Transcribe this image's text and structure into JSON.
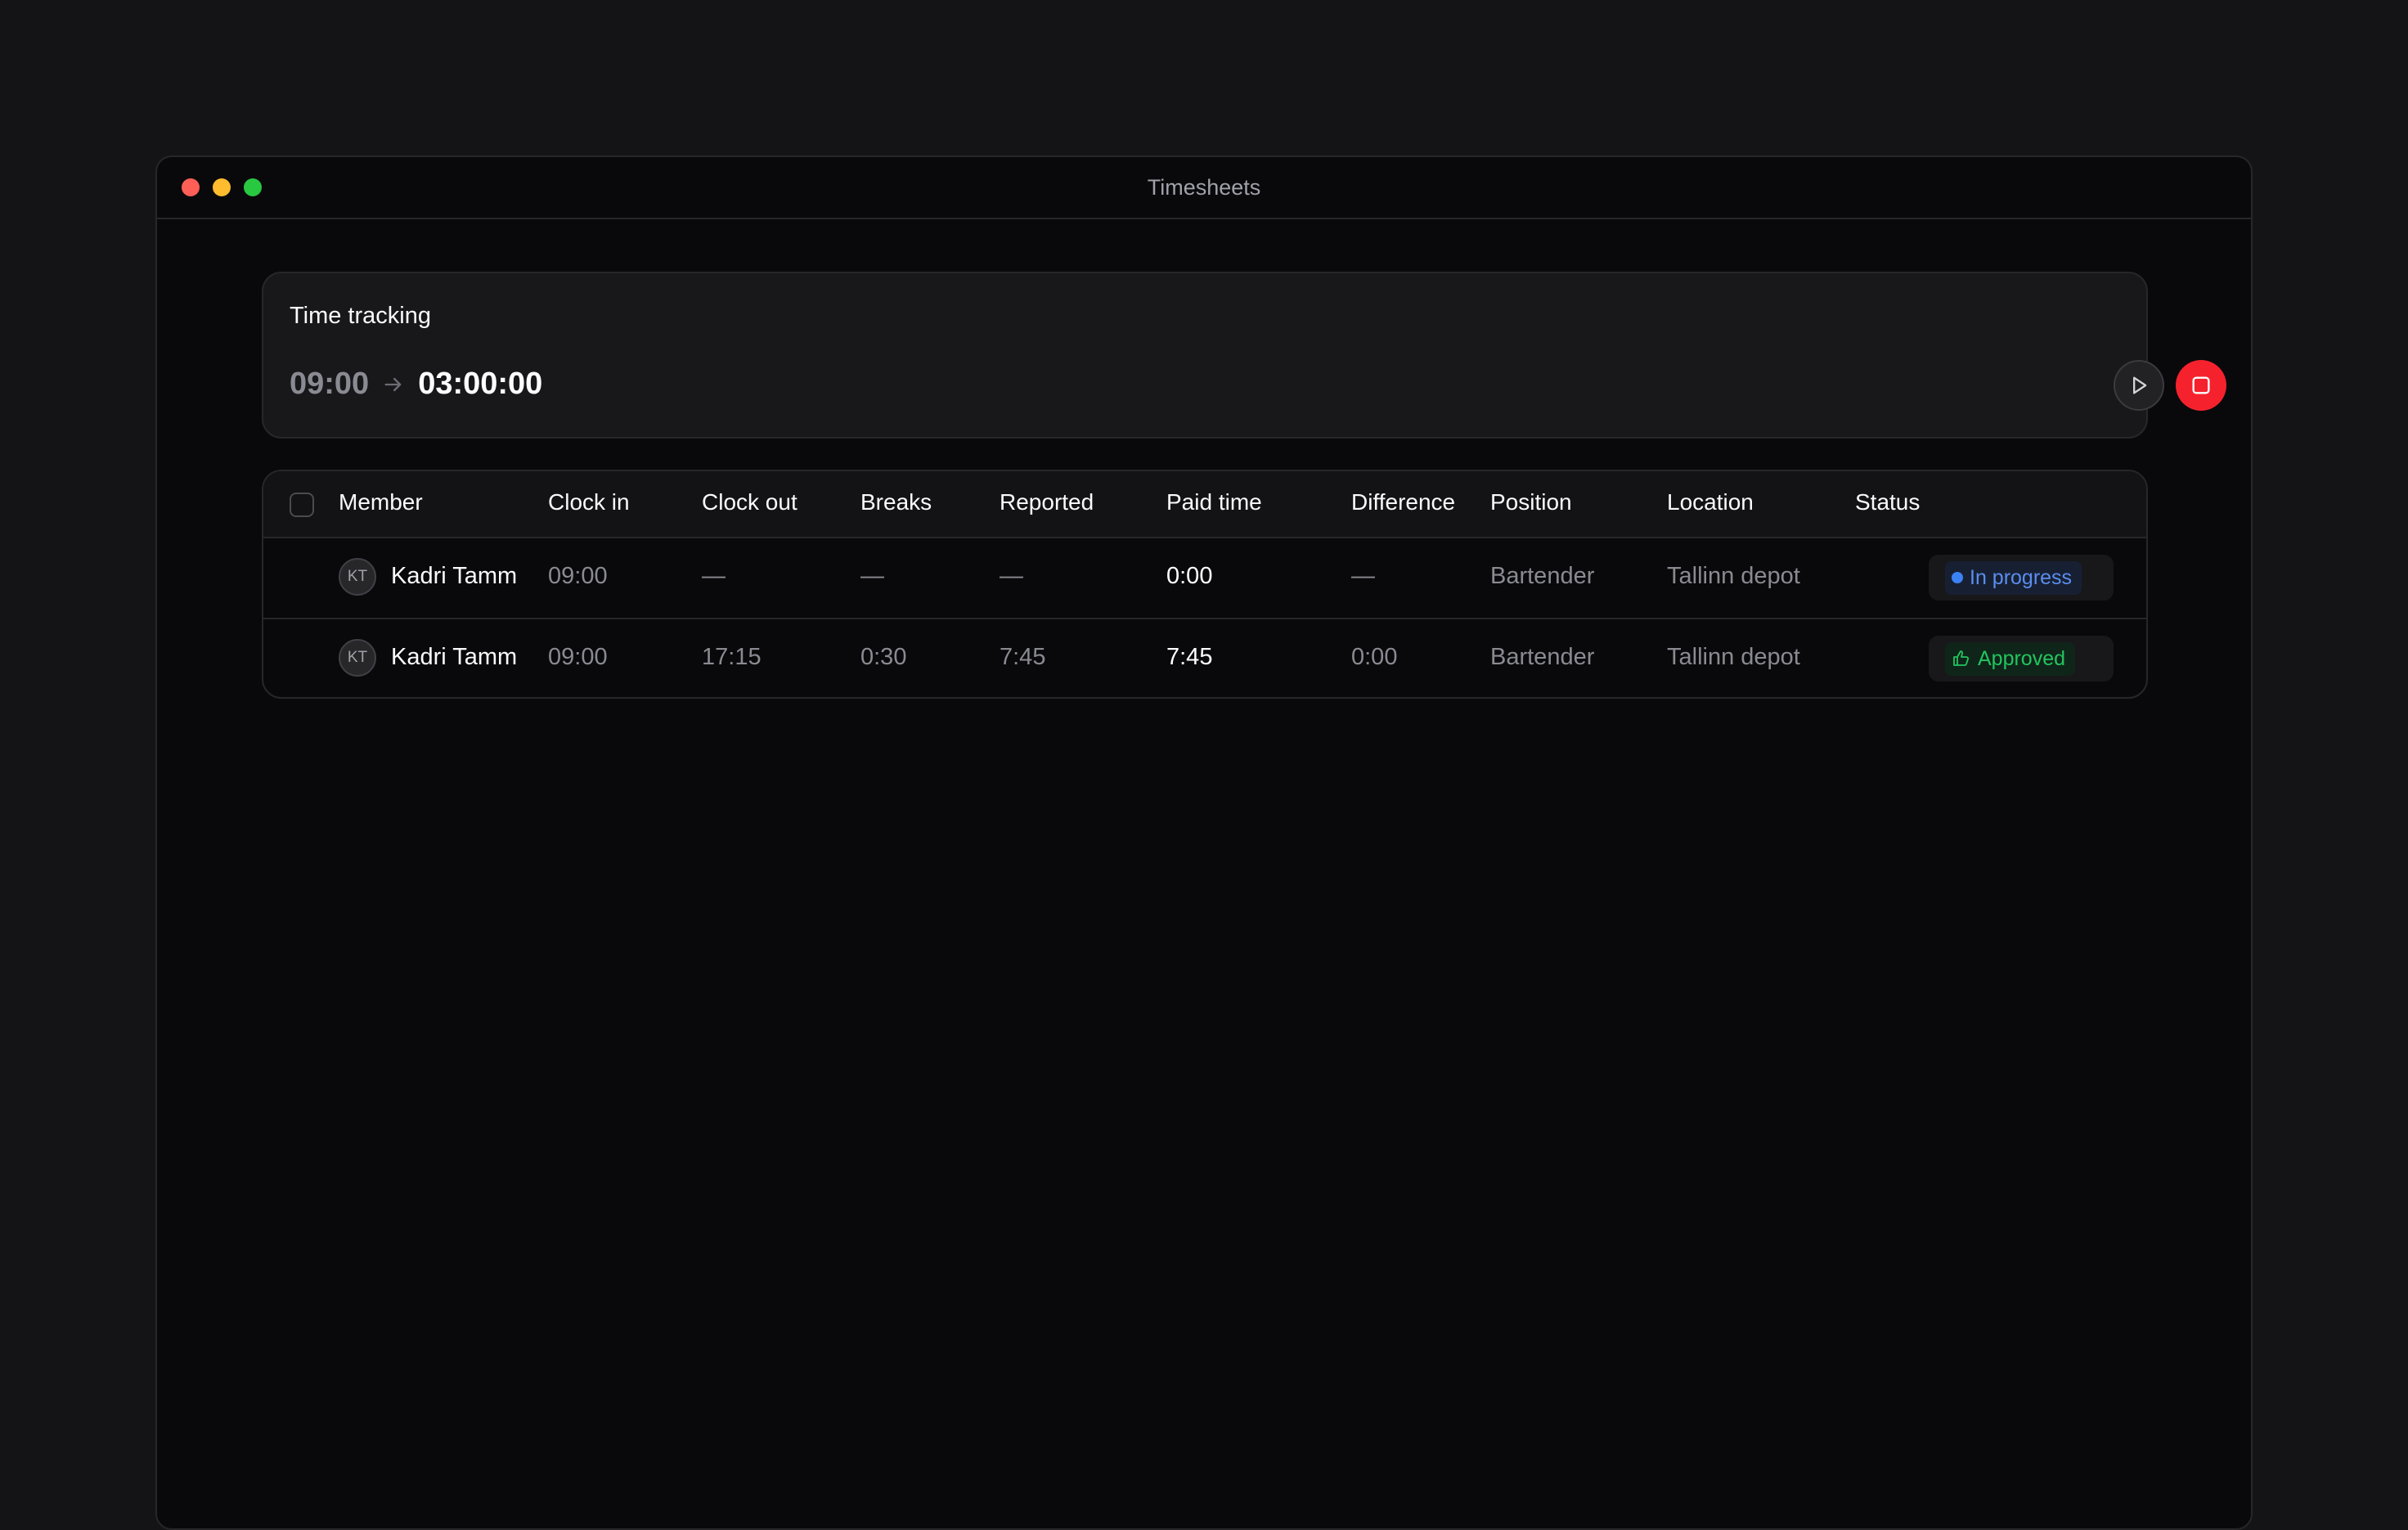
{
  "window": {
    "title": "Timesheets"
  },
  "tracking": {
    "title": "Time tracking",
    "start_time": "09:00",
    "elapsed": "03:00:00",
    "play_icon": "play-icon",
    "stop_icon": "stop-icon",
    "stop_color": "#f5222d"
  },
  "table": {
    "headers": {
      "member": "Member",
      "clock_in": "Clock in",
      "clock_out": "Clock out",
      "breaks": "Breaks",
      "reported": "Reported",
      "paid_time": "Paid time",
      "difference": "Difference",
      "position": "Position",
      "location": "Location",
      "status": "Status"
    },
    "rows": [
      {
        "initials": "KT",
        "member": "Kadri Tamm",
        "clock_in": "09:00",
        "clock_out": "—",
        "breaks": "—",
        "reported": "—",
        "paid_time": "0:00",
        "difference": "—",
        "position": "Bartender",
        "location": "Tallinn depot",
        "status": "In progress",
        "status_color": "#5b8def"
      },
      {
        "initials": "KT",
        "member": "Kadri Tamm",
        "clock_in": "09:00",
        "clock_out": "17:15",
        "breaks": "0:30",
        "reported": "7:45",
        "paid_time": "7:45",
        "difference": "0:00",
        "position": "Bartender",
        "location": "Tallinn depot",
        "status": "Approved",
        "status_color": "#22c55e"
      }
    ]
  }
}
